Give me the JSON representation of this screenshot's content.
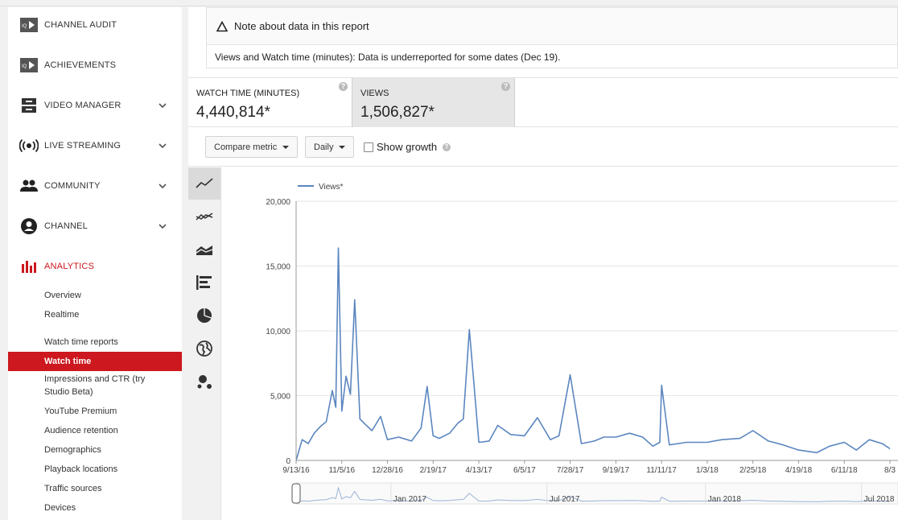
{
  "sidebar": {
    "items": [
      {
        "label": "CHANNEL AUDIT",
        "icon": "channel-audit-icon"
      },
      {
        "label": "ACHIEVEMENTS",
        "icon": "achievements-icon"
      },
      {
        "label": "VIDEO MANAGER",
        "icon": "video-manager-icon"
      },
      {
        "label": "LIVE STREAMING",
        "icon": "live-streaming-icon"
      },
      {
        "label": "COMMUNITY",
        "icon": "community-icon"
      },
      {
        "label": "CHANNEL",
        "icon": "channel-icon"
      },
      {
        "label": "ANALYTICS",
        "icon": "analytics-icon"
      }
    ],
    "analytics_sub": [
      "Overview",
      "Realtime",
      "Watch time reports",
      "Watch time",
      "Impressions and CTR (try",
      "Studio Beta)",
      "YouTube Premium",
      "Audience retention",
      "Demographics",
      "Playback locations",
      "Traffic sources",
      "Devices"
    ],
    "accent_color": "#cc181e"
  },
  "note": {
    "title": "Note about data in this report",
    "body": "Views and Watch time (minutes): Data is underreported for some dates (Dec 19)."
  },
  "metrics": [
    {
      "label": "WATCH TIME (MINUTES)",
      "value": "4,440,814*"
    },
    {
      "label": "VIEWS",
      "value": "1,506,827*"
    }
  ],
  "toolbar": {
    "compare_label": "Compare metric",
    "interval_label": "Daily",
    "growth_label": "Show growth"
  },
  "chart_types": [
    "line-chart-icon",
    "multi-line-chart-icon",
    "stacked-area-icon",
    "bar-chart-icon",
    "pie-chart-icon",
    "map-globe-icon",
    "bubble-chart-icon"
  ],
  "chart_data": {
    "type": "line",
    "legend": "Views*",
    "series_color": "#5b86bf",
    "ylim": [
      0,
      20000
    ],
    "yticks": [
      "0",
      "5,000",
      "10,000",
      "15,000",
      "20,000"
    ],
    "xticks": [
      "9/13/16",
      "11/5/16",
      "12/28/16",
      "2/19/17",
      "4/13/17",
      "6/5/17",
      "7/28/17",
      "9/19/17",
      "11/11/17",
      "1/3/18",
      "2/25/18",
      "4/19/18",
      "6/11/18",
      "8/3"
    ],
    "x": [
      "9/13/16",
      "9/20/16",
      "9/27/16",
      "10/4/16",
      "10/11/16",
      "10/18/16",
      "10/25/16",
      "10/29/16",
      "11/1/16",
      "11/5/16",
      "11/10/16",
      "11/15/16",
      "11/20/16",
      "11/26/16",
      "12/2/16",
      "12/10/16",
      "12/20/16",
      "12/28/16",
      "1/10/17",
      "1/25/17",
      "2/5/17",
      "2/12/17",
      "2/19/17",
      "2/26/17",
      "3/10/17",
      "3/20/17",
      "3/26/17",
      "4/2/17",
      "4/13/17",
      "4/25/17",
      "5/5/17",
      "5/20/17",
      "6/5/17",
      "6/20/17",
      "7/5/17",
      "7/15/17",
      "7/28/17",
      "8/10/17",
      "8/25/17",
      "9/5/17",
      "9/19/17",
      "10/5/17",
      "10/20/17",
      "11/1/17",
      "11/9/17",
      "11/11/17",
      "11/20/17",
      "12/10/17",
      "1/3/18",
      "1/20/18",
      "2/10/18",
      "2/25/18",
      "3/15/18",
      "4/1/18",
      "4/19/18",
      "5/10/18",
      "5/25/18",
      "6/11/18",
      "6/25/18",
      "7/10/18",
      "7/25/18",
      "8/3/18"
    ],
    "values": [
      0,
      1600,
      1300,
      2100,
      2600,
      3000,
      5400,
      4100,
      16400,
      3800,
      6500,
      5100,
      12400,
      3200,
      2800,
      2300,
      3400,
      1600,
      1800,
      1500,
      2500,
      5700,
      1900,
      1700,
      2100,
      2900,
      3200,
      10100,
      1400,
      1500,
      2700,
      2000,
      1900,
      3300,
      1600,
      1900,
      6600,
      1300,
      1500,
      1800,
      1800,
      2100,
      1800,
      1100,
      1400,
      5800,
      1200,
      1400,
      1400,
      1600,
      1700,
      2300,
      1500,
      1200,
      800,
      600,
      1100,
      1400,
      800,
      1600,
      1300,
      900
    ]
  },
  "navigator": {
    "labels": [
      "Jan 2017",
      "Jul 2017",
      "Jan 2018",
      "Jul 2018"
    ]
  }
}
